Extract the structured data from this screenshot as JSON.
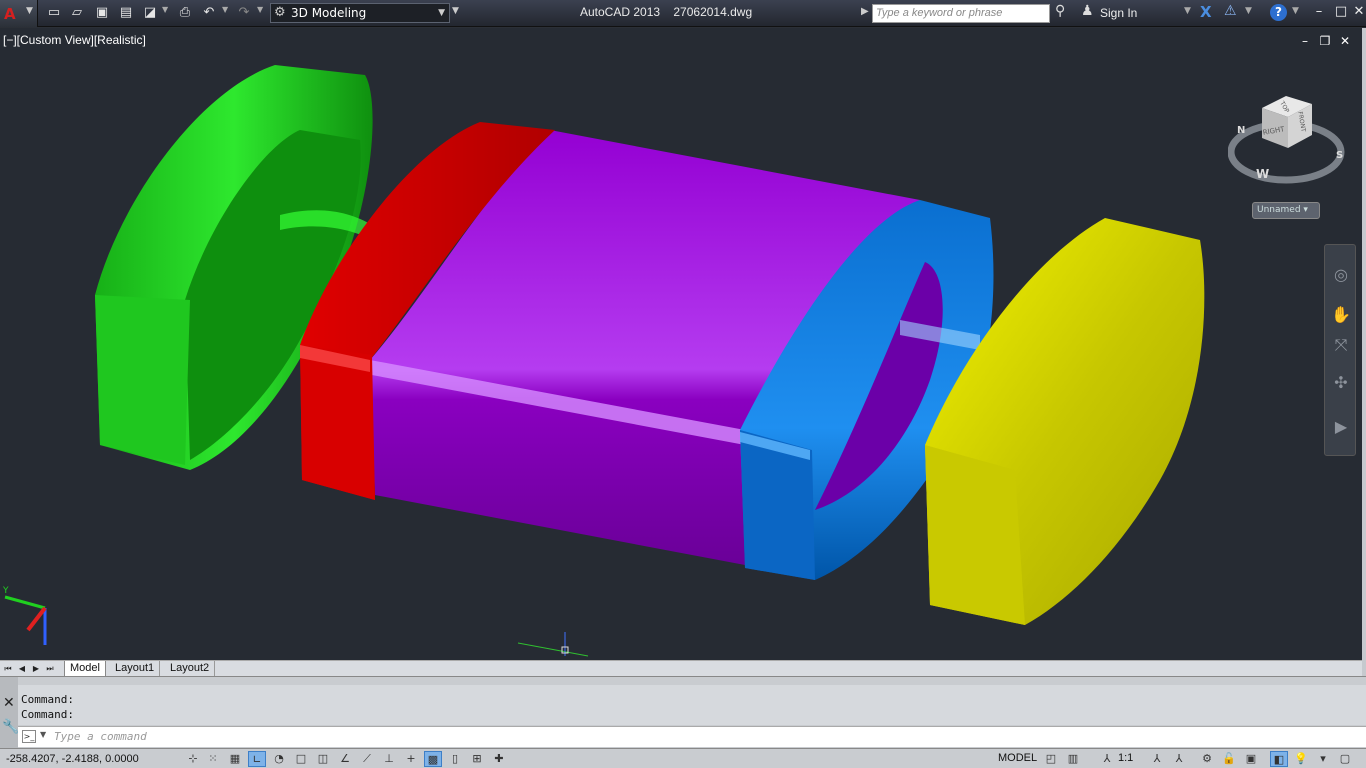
{
  "app": {
    "title": "AutoCAD 2013    27062014.dwg",
    "workspace": "3D Modeling",
    "search_placeholder": "Type a keyword or phrase",
    "sign_in": "Sign In"
  },
  "viewport": {
    "label": "[−][Custom View][Realistic]",
    "viewcube": {
      "faces": [
        "TOP",
        "RIGHT",
        "FRONT"
      ],
      "compass": [
        "N",
        "W",
        "S"
      ]
    },
    "view_name": "Unnamed"
  },
  "tabs": [
    "Model",
    "Layout1",
    "Layout2"
  ],
  "command": {
    "history": [
      "Command:",
      "Command:"
    ],
    "placeholder": "Type a command"
  },
  "status": {
    "coords": "-258.4207, -2.4188, 0.0000",
    "model": "MODEL",
    "scale": "1:1"
  },
  "colors": {
    "green_part": "#1ec21e",
    "red_part": "#d00000",
    "purple_part": "#9d00d0",
    "blue_part": "#0a6fd0",
    "yellow_part": "#e6e600",
    "viewport_bg": "#262b33"
  },
  "icons": {
    "app_menu": "autocad-logo-icon",
    "new": "new-file-icon",
    "open": "open-folder-icon",
    "save": "save-icon",
    "save_as": "save-as-icon",
    "plot": "print-icon",
    "undo": "undo-icon",
    "redo": "redo-icon"
  }
}
